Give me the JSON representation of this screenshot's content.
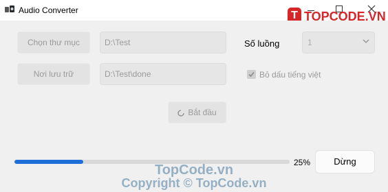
{
  "window": {
    "title": "Audio Converter",
    "icon": "audio-converter-icon"
  },
  "logo": {
    "mark": "T",
    "text": "TOPCODE.VN",
    "color": "#d6262a"
  },
  "form": {
    "choose_folder_button": "Chọn thư mục",
    "source_path": "D:\\Test",
    "output_button": "Nơi lưu trữ",
    "output_path": "D:\\Test\\done",
    "threads_label": "Số luồng",
    "threads_value": "1",
    "remove_accents_label": "Bỏ dấu tiếng việt",
    "remove_accents_checked": true,
    "start_button": "Bắt đầu"
  },
  "progress": {
    "percent": 25,
    "label": "25%",
    "fill_color": "#1f6fd8"
  },
  "stop_button": "Dừng",
  "watermarks": {
    "line1": "TopCode.vn",
    "line2": "Copyright © TopCode.vn"
  }
}
